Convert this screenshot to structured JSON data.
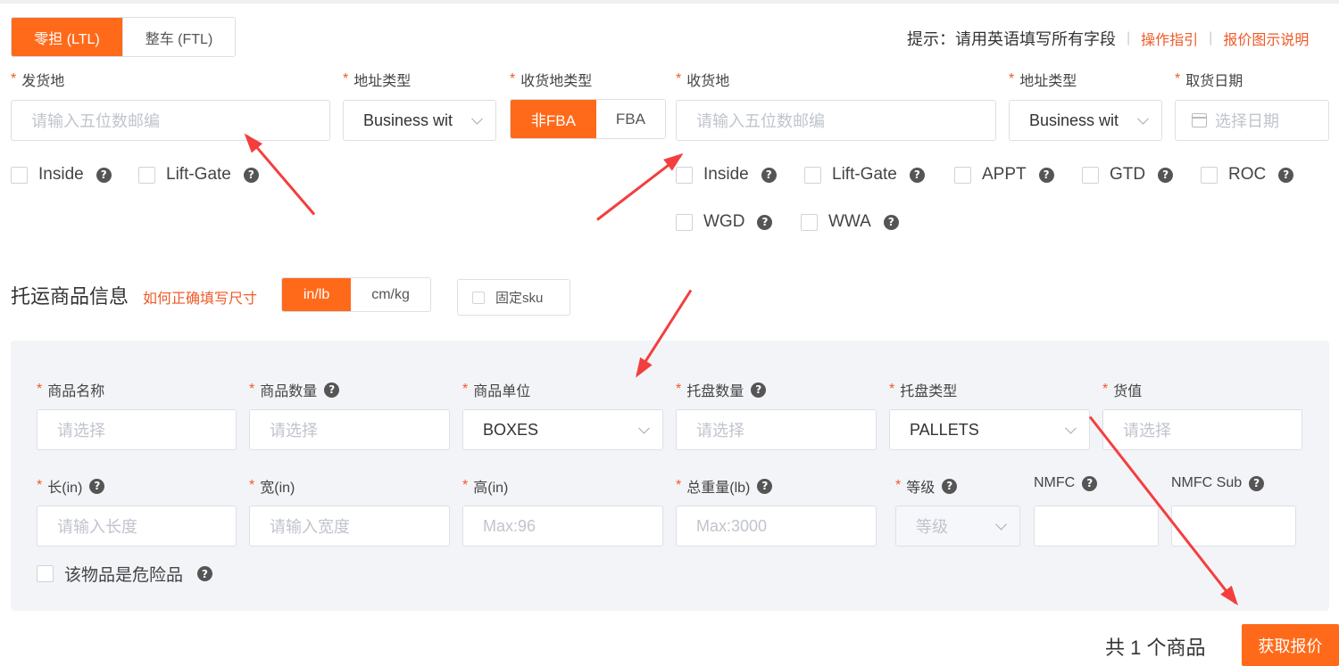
{
  "mode_tabs": [
    "零担 (LTL)",
    "整车 (FTL)"
  ],
  "hint": {
    "text": "提示：请用英语填写所有字段",
    "guide_link": "操作指引",
    "quote_link": "报价图示说明"
  },
  "origin": {
    "label": "发货地",
    "placeholder": "请输入五位数邮编",
    "addr_type_label": "地址类型",
    "addr_type_value": "Business wit",
    "options": [
      "Inside",
      "Lift-Gate"
    ]
  },
  "dest_type": {
    "label": "收货地类型",
    "options": [
      "非FBA",
      "FBA"
    ]
  },
  "destination": {
    "label": "收货地",
    "placeholder": "请输入五位数邮编",
    "addr_type_label": "地址类型",
    "addr_type_value": "Business wit",
    "options": [
      "Inside",
      "Lift-Gate",
      "APPT",
      "GTD",
      "ROC",
      "WGD",
      "WWA"
    ]
  },
  "pickup": {
    "label": "取货日期",
    "placeholder": "选择日期"
  },
  "goods": {
    "title": "托运商品信息",
    "size_link": "如何正确填写尺寸",
    "unit_tabs": [
      "in/lb",
      "cm/kg"
    ],
    "fixed_sku": "固定sku",
    "fields_row1": [
      {
        "label": "商品名称",
        "value": "请选择"
      },
      {
        "label": "商品数量",
        "value": "请选择"
      },
      {
        "label": "商品单位",
        "value": "BOXES"
      },
      {
        "label": "托盘数量",
        "value": "请选择"
      },
      {
        "label": "托盘类型",
        "value": "PALLETS"
      },
      {
        "label": "货值",
        "value": "请选择"
      }
    ],
    "fields_row2": [
      {
        "label": "长(in)",
        "value": "请输入长度"
      },
      {
        "label": "宽(in)",
        "value": "请输入宽度"
      },
      {
        "label": "高(in)",
        "value": "Max:96"
      },
      {
        "label": "总重量(lb)",
        "value": "Max:3000"
      },
      {
        "label": "等级",
        "value": "等级"
      },
      {
        "label": "NMFC",
        "value": ""
      },
      {
        "label": "NMFC Sub",
        "value": ""
      }
    ],
    "hazmat": "该物品是危险品"
  },
  "footer": {
    "count_text": "共 1 个商品",
    "submit": "获取报价"
  },
  "colors": {
    "accent": "#ff6a1a",
    "annotation_arrow": "#f43e3e"
  }
}
